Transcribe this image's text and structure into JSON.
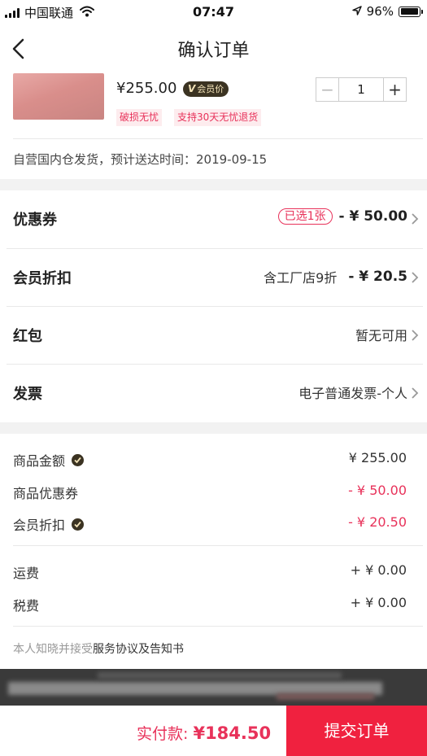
{
  "status_bar": {
    "carrier": "中国联通",
    "time": "07:47",
    "battery": "96%",
    "battery_level": 0.96
  },
  "nav": {
    "title": "确认订单"
  },
  "product": {
    "price": "¥255.00",
    "member_badge": "会员价",
    "tags": [
      "破损无忧",
      "支持30天无忧退货"
    ],
    "quantity": "1",
    "minus": "−",
    "plus": "+"
  },
  "delivery": {
    "text": "自营国内仓发货，预计送达时间：2019-09-15"
  },
  "options": {
    "coupon": {
      "label": "优惠券",
      "selected": "已选1张",
      "amount": "- ¥ 50.00"
    },
    "member_discount": {
      "label": "会员折扣",
      "detail": "含工厂店9折",
      "amount": "- ¥ 20.5"
    },
    "red_packet": {
      "label": "红包",
      "detail": "暂无可用"
    },
    "invoice": {
      "label": "发票",
      "detail": "电子普通发票-个人"
    }
  },
  "summary": {
    "goods_amount": {
      "label": "商品金额",
      "value": "¥ 255.00"
    },
    "goods_coupon": {
      "label": "商品优惠券",
      "value": "- ¥ 50.00"
    },
    "member_discount": {
      "label": "会员折扣",
      "value": "- ¥ 20.50"
    },
    "shipping": {
      "label": "运费",
      "value": "+ ¥ 0.00"
    },
    "tax": {
      "label": "税费",
      "value": "+ ¥ 0.00"
    }
  },
  "agreement": {
    "prefix": "本人知晓并接受",
    "link": "服务协议及告知书"
  },
  "footer": {
    "pay_label": "实付款:",
    "pay_amount": "¥184.50",
    "submit": "提交订单"
  },
  "colors": {
    "accent_red": "#f0213f",
    "price_red": "#e8325a",
    "badge_dark": "#3b3322"
  }
}
